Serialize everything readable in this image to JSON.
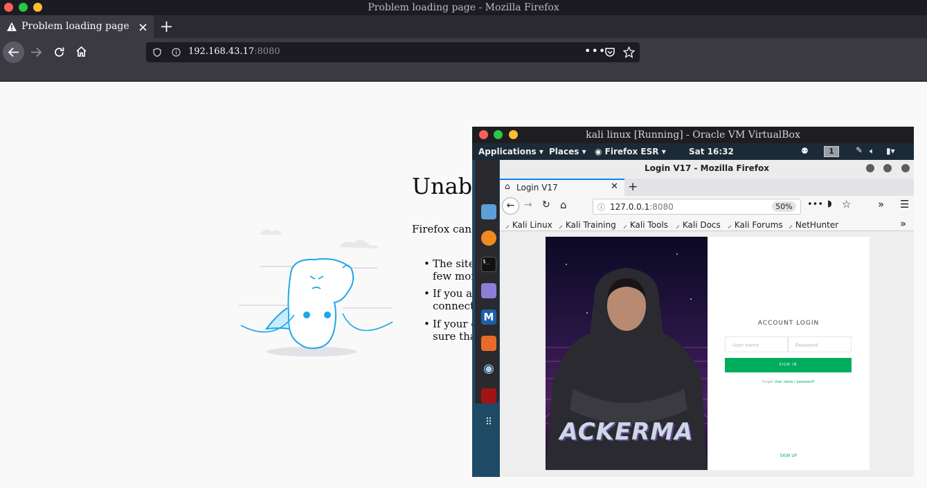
{
  "window": {
    "title": "Problem loading page - Mozilla Firefox"
  },
  "tab": {
    "title": "Problem loading page",
    "icon": "warning-icon"
  },
  "urlbar": {
    "host": "192.168.43.17",
    "port": ":8080"
  },
  "error_page": {
    "title": "Unable",
    "intro": "Firefox can’t es",
    "bullets": [
      {
        "line1": "The site c",
        "line2": "few mom"
      },
      {
        "line1": "If you are",
        "line2": "connectio"
      },
      {
        "line1": "If your co",
        "line2": "sure that"
      }
    ]
  },
  "vbox": {
    "title": "kali linux [Running] - Oracle VM VirtualBox",
    "panel": {
      "applications": "Applications",
      "places": "Places",
      "firefox": "Firefox ESR",
      "clock": "Sat 16:32",
      "workspace": "1"
    },
    "inner_firefox": {
      "title": "Login V17 - Mozilla Firefox",
      "tab_title": "Login V17",
      "url_host": "127.0.0.1",
      "url_port": ":8080",
      "zoom": "50%",
      "bookmarks": [
        "Kali Linux",
        "Kali Training",
        "Kali Tools",
        "Kali Docs",
        "Kali Forums",
        "NetHunter"
      ],
      "login": {
        "heading": "ACCOUNT LOGIN",
        "username_placeholder": "User name",
        "password_placeholder": "Password",
        "signin_label": "SIGN IN",
        "forgot_prefix": "Forgot",
        "forgot_link": "User name / password?",
        "signup_label": "SIGN UP",
        "banner_text": "ACKERMA"
      }
    }
  },
  "colors": {
    "signin_green": "#00ad5f",
    "link_green": "#00ad5f",
    "tab_accent": "#0a84ff"
  }
}
